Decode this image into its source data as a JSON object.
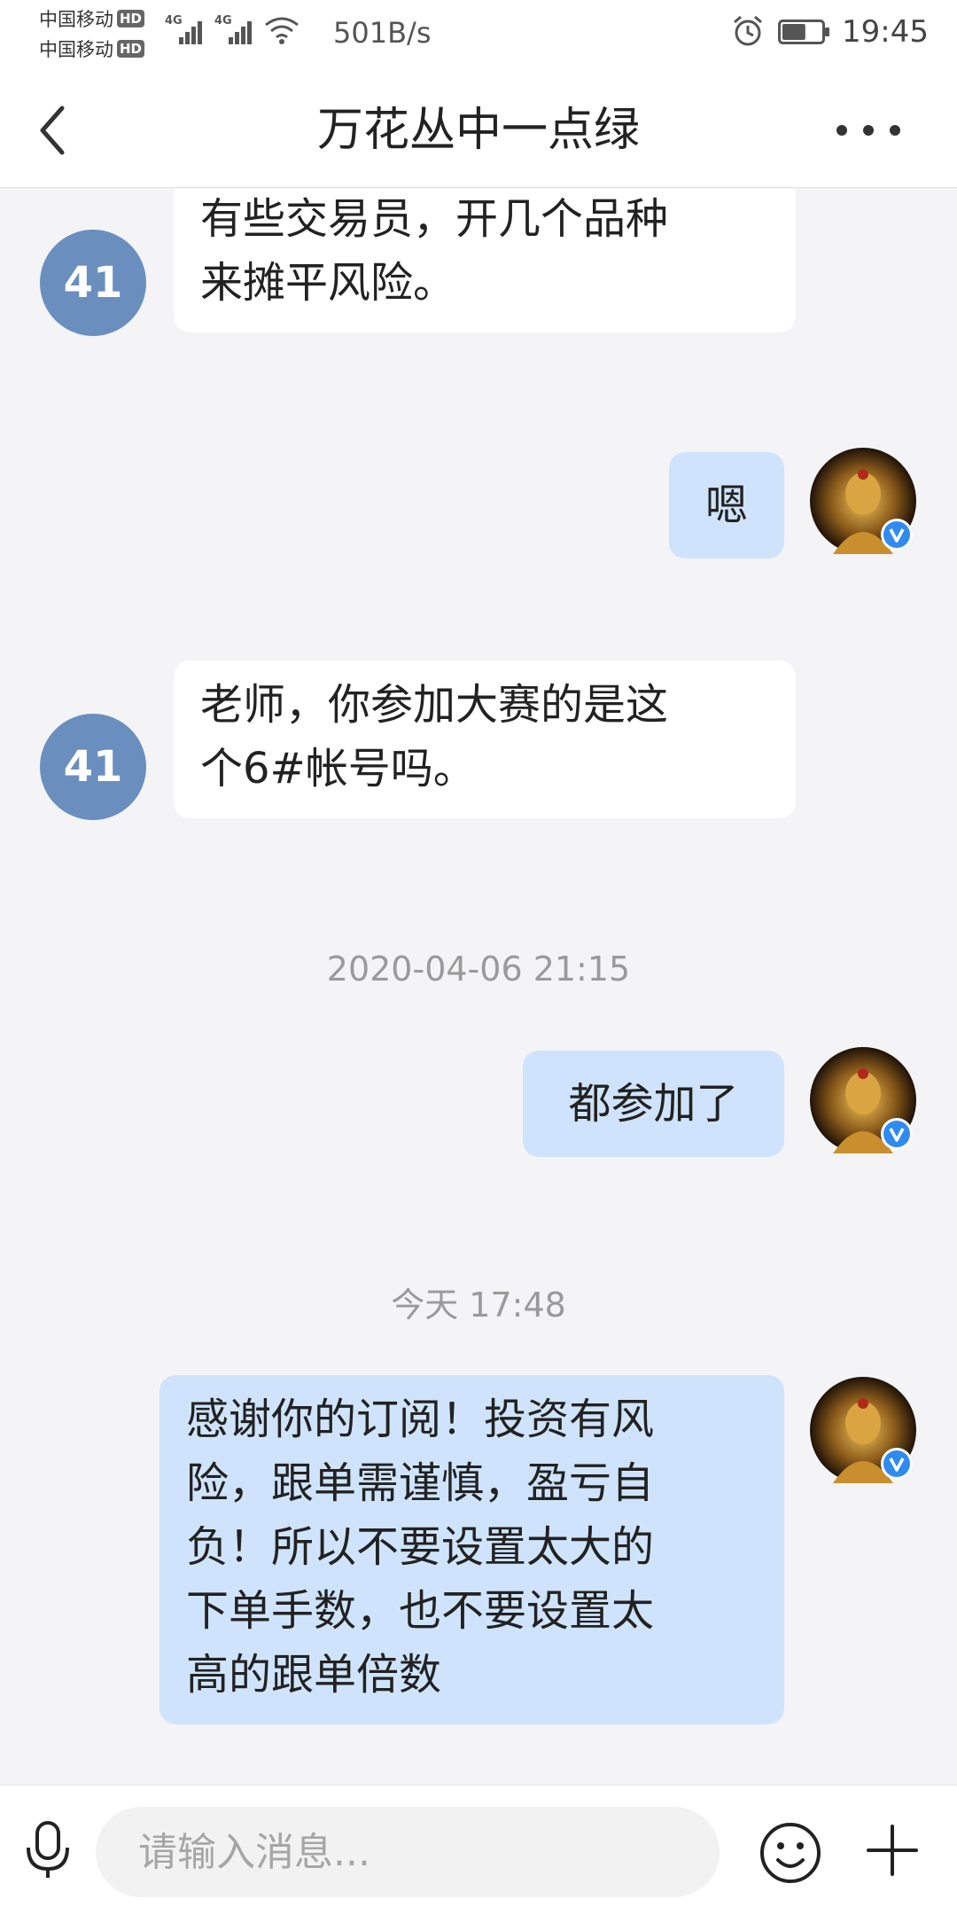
{
  "status_bar": {
    "carrier1": "中国移动",
    "carrier2": "中国移动",
    "hd_label": "HD",
    "network_tag": "4G",
    "net_speed": "501B/s",
    "time": "19:45",
    "battery_level": 0.6,
    "icons": [
      "signal-icon",
      "wifi-icon",
      "alarm-icon",
      "battery-icon"
    ]
  },
  "header": {
    "title": "万花丛中一点绿",
    "back_icon": "chevron-left-icon",
    "more_icon": "more-dots-icon"
  },
  "messages": [
    {
      "side": "in",
      "avatar_text": "41",
      "text_lines": [
        "有些交易员，开几个品种",
        "来摊平风险。"
      ]
    },
    {
      "side": "out",
      "text_lines": [
        "嗯"
      ]
    },
    {
      "side": "in",
      "avatar_text": "41",
      "text_lines": [
        "老师，你参加大赛的是这",
        "个6#帐号吗。"
      ]
    },
    {
      "timestamp": "2020-04-06 21:15"
    },
    {
      "side": "out",
      "text_lines": [
        "都参加了"
      ]
    },
    {
      "timestamp": "今天 17:48"
    },
    {
      "side": "out",
      "text_lines": [
        "感谢你的订阅！投资有风",
        "险，跟单需谨慎，盈亏自",
        "负！所以不要设置太大的",
        "下单手数，也不要设置太",
        "高的跟单倍数"
      ]
    }
  ],
  "input_bar": {
    "placeholder": "请输入消息...",
    "value": "",
    "icons": [
      "microphone-icon",
      "emoji-icon",
      "plus-icon"
    ]
  },
  "colors": {
    "background": "#f4f4f6",
    "incoming_bubble": "#ffffff",
    "outgoing_bubble": "#cfe4fc",
    "number_avatar": "#6a8fbf",
    "verified_badge": "#2f8bf0"
  }
}
